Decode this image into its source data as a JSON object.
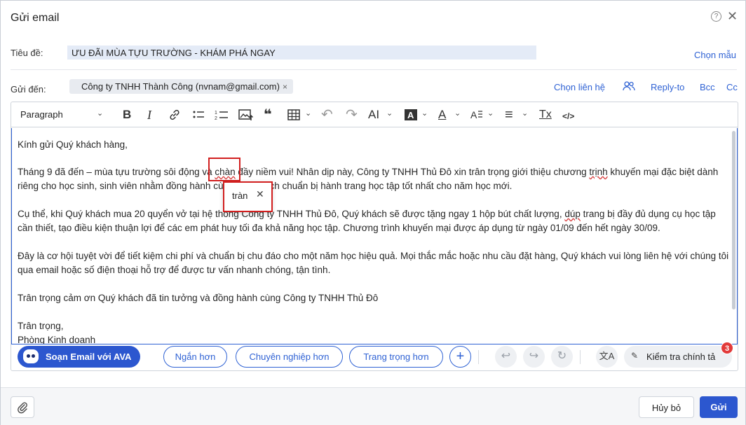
{
  "dialog": {
    "title": "Gửi email",
    "help_symbol": "?",
    "close_symbol": "✕"
  },
  "subject": {
    "label": "Tiêu đề:",
    "value": "ƯU ĐÃI MÙA TỰU TRƯỜNG - KHÁM PHÁ NGAY",
    "choose_template": "Chọn mẫu"
  },
  "recipients": {
    "label": "Gửi đến:",
    "chip": "Công ty TNHH Thành Công (nvnam@gmail.com)",
    "chip_remove": "×",
    "choose_contact": "Chọn liên hệ",
    "reply_to": "Reply-to",
    "bcc": "Bcc",
    "cc": "Cc"
  },
  "toolbar": {
    "paragraph": "Paragraph",
    "bold": "B",
    "italic": "I",
    "quote": "❝",
    "undo": "↶",
    "redo": "↷",
    "font_size": "AI",
    "text_color": "A",
    "align": "≡",
    "clear_format": "Tx",
    "source": "</>"
  },
  "body": {
    "greeting": "Kính gửi Quý khách hàng,",
    "p1_a": "Tháng 9 đã đến – mùa tựu trường sôi động và ",
    "p1_err": "chàn",
    "p1_b": " đầy niềm vui! Nhân dịp này, Công ty TNHH Thủ Đô xin trân trọng giới thiệu chương ",
    "p1_err2": "trịnh",
    "p1_c": " khuyến mại đặc biệt dành riêng cho học sinh, sinh viên nhằm đồng hành cùng quý khách chuẩn bị hành trang học tập tốt nhất cho năm học mới.",
    "p2_a": "Cụ thể, khi Quý khách mua 20 quyển vở tại hệ thống Công ty TNHH Thủ Đô, Quý khách sẽ được tặng ngay 1 hộp bút chất lượng, ",
    "p2_err": "dúp",
    "p2_b": " trang bị đầy đủ dụng cụ học tập cần thiết, tạo điều kiện thuận lợi để các em phát huy tối đa khả năng học tập. Chương trình khuyến mại được áp dụng từ ngày 01/09 đến hết ngày 30/09.",
    "p3": "Đây là cơ hội tuyệt vời để tiết kiệm chi phí và chuẩn bị chu đáo cho một năm học hiệu quả. Mọi thắc mắc hoặc nhu cầu đặt hàng, Quý khách vui lòng liên hệ với chúng tôi qua email hoặc số điện thoại hỗ trợ để được tư vấn nhanh chóng, tận tình.",
    "p4": "Trân trọng cảm ơn Quý khách đã tin tưởng và đồng hành cùng Công ty TNHH Thủ Đô",
    "closing": "Trân trọng,",
    "signature": "Phòng Kinh doanh"
  },
  "suggestion": {
    "word": "tràn",
    "dismiss": "✕"
  },
  "assistant": {
    "ava": "Soạn Email với AVA",
    "shorter": "Ngắn hơn",
    "professional": "Chuyên nghiệp hơn",
    "formal": "Trang trọng hơn",
    "add": "+",
    "spellcheck": "Kiểm tra chính tả",
    "spell_count": "3"
  },
  "footer": {
    "cancel": "Hủy bỏ",
    "send": "Gửi"
  }
}
